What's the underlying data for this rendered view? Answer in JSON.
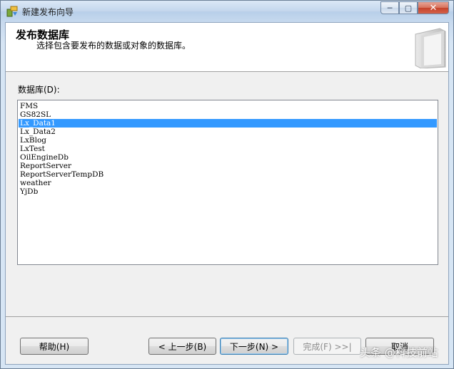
{
  "window": {
    "title": "新建发布向导",
    "minimize_glyph": "─",
    "maximize_glyph": "▢",
    "close_glyph": "✕"
  },
  "header": {
    "title": "发布数据库",
    "subtitle": "选择包含要发布的数据或对象的数据库。"
  },
  "database_list": {
    "label": "数据库(D):",
    "items": [
      "FMS",
      "GS82SL",
      "Lx_Data1",
      "Lx_Data2",
      "LxBlog",
      "LxTest",
      "OilEngineDb",
      "ReportServer",
      "ReportServerTempDB",
      "weather",
      "YjDb"
    ],
    "selected": "Lx_Data1"
  },
  "buttons": {
    "help": "帮助(H)",
    "back": "< 上一步(B)",
    "next": "下一步(N) >",
    "finish": "完成(F) >>|",
    "cancel": "取消"
  },
  "watermark": "头条 @科技前站"
}
